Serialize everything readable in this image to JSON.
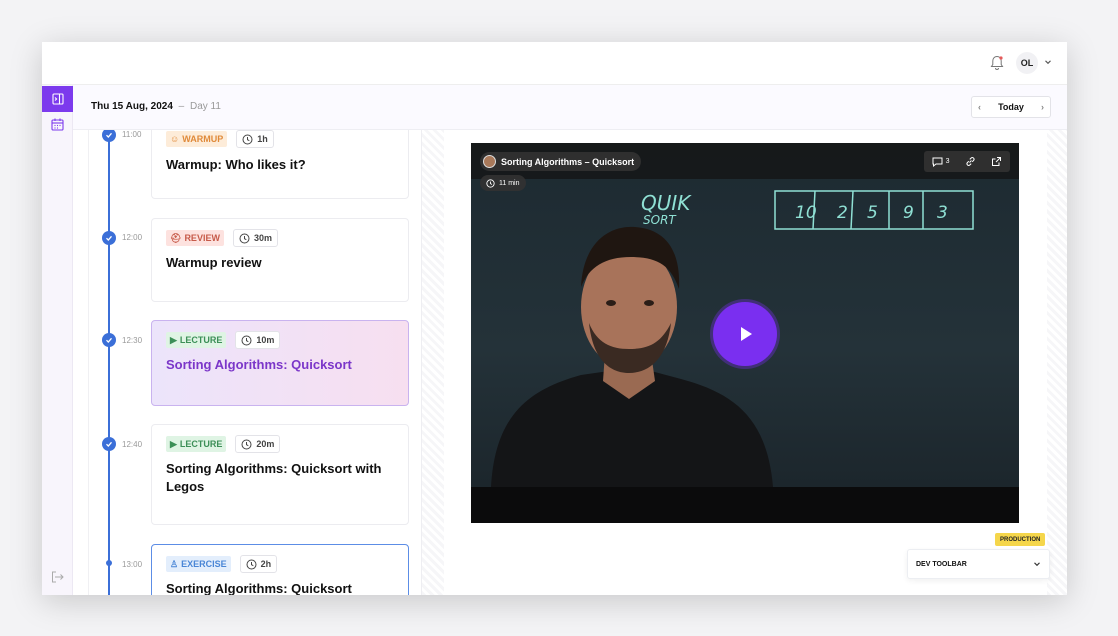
{
  "topbar": {
    "avatar_initials": "OL"
  },
  "datebar": {
    "date": "Thu 15 Aug, 2024",
    "separator": "–",
    "day": "Day 11",
    "today_label": "Today"
  },
  "schedule": {
    "items": [
      {
        "time": "11:00",
        "tag": "WARMUP",
        "tag_icon": "smile-icon",
        "duration": "1h",
        "title": "Warmup: Who likes it?"
      },
      {
        "time": "12:00",
        "tag": "REVIEW",
        "tag_icon": "helmet-icon",
        "duration": "30m",
        "title": "Warmup review"
      },
      {
        "time": "12:30",
        "tag": "LECTURE",
        "tag_icon": "play-square-icon",
        "duration": "10m",
        "title": "Sorting Algorithms: Quicksort"
      },
      {
        "time": "12:40",
        "tag": "LECTURE",
        "tag_icon": "play-square-icon",
        "duration": "20m",
        "title": "Sorting Algorithms: Quicksort with Legos"
      },
      {
        "time": "13:00",
        "tag": "EXERCISE",
        "tag_icon": "person-icon",
        "duration": "2h",
        "title": "Sorting Algorithms: Quicksort"
      }
    ]
  },
  "video": {
    "title": "Sorting Algorithms – Quicksort",
    "comment_count": "3",
    "duration": "11 min",
    "board_word_1": "QUIK",
    "board_word_2": "SORT",
    "board_numbers": [
      "10",
      "2",
      "5",
      "9",
      "3"
    ]
  },
  "dev": {
    "env_badge": "PRODUCTION",
    "toolbar_label": "DEV TOOLBAR"
  },
  "colors": {
    "accent": "#7c3aed",
    "timeline": "#3b6fd8",
    "active_title": "#7b36c9"
  }
}
